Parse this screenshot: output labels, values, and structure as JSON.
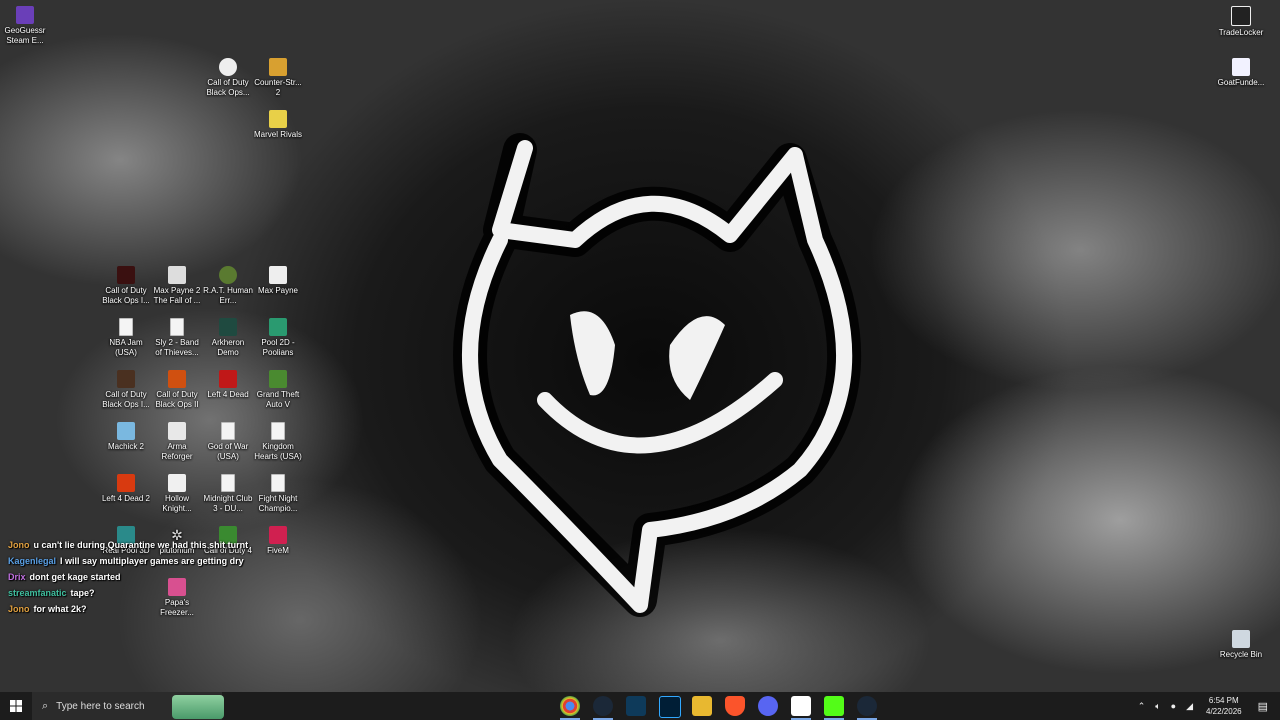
{
  "desktop_icons": {
    "geoguessr": "GeoGuessr Steam E...",
    "cod_bo_top": "Call of Duty Black Ops...",
    "cs2": "Counter-Str... 2",
    "marvel_rivals": "Marvel Rivals",
    "tradelocker": "TradeLocker",
    "goatfunded": "GoatFunde...",
    "recycle_bin": "Recycle Bin",
    "cod_bo_3": "Call of Duty Black Ops I...",
    "max_payne_2": "Max Payne 2 The Fall of ...",
    "rat": "R.A.T. Human Err...",
    "max_payne": "Max Payne",
    "nba_jam": "NBA Jam (USA)",
    "sly2": "Sly 2 - Band of Thieves...",
    "arkheron": "Arkheron Demo",
    "pool2d": "Pool 2D - Poolians",
    "cod_bo_1": "Call of Duty Black Ops I...",
    "cod_bo_2": "Call of Duty Black Ops II",
    "l4d": "Left 4 Dead",
    "gta5": "Grand Theft Auto V",
    "machick": "Machick 2",
    "arma": "Arma Reforger",
    "gow": "God of War (USA)",
    "kh": "Kingdom Hearts (USA)",
    "l4d2": "Left 4 Dead 2",
    "hollow": "Hollow Knight...",
    "midnight": "Midnight Club 3 - DU...",
    "fightnight": "Fight Night Champio...",
    "realpool": "Real Pool 3D",
    "plutonium": "plutonium",
    "cod4": "Call of Duty 4",
    "fivem": "FiveM",
    "papas": "Papa's Freezer..."
  },
  "chat": [
    {
      "user": "Jono",
      "msg": "u can't lie during Quarantine we had this shit turnt",
      "color": "#e0a040"
    },
    {
      "user": "Kagenlegal",
      "msg": "I will say multiplayer games are getting dry",
      "color": "#5aa0e6"
    },
    {
      "user": "Drix",
      "msg": "dont get kage started",
      "color": "#c070e0"
    },
    {
      "user": "streamfanatic",
      "msg": "tape?",
      "color": "#40c0a0"
    },
    {
      "user": "Jono",
      "msg": "for what 2k?",
      "color": "#e0a040"
    }
  ],
  "taskbar": {
    "search_placeholder": "Type here to search",
    "time": "6:54 PM",
    "date": "4/22/2026"
  },
  "colors": {
    "taskbar": "#1c1c1c",
    "accent": "#7aa7e6"
  }
}
